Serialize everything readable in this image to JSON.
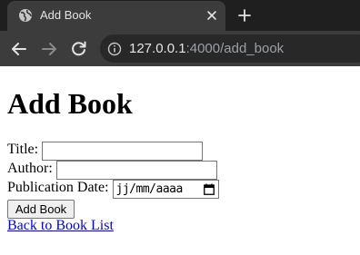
{
  "browser": {
    "tab_title": "Add Book",
    "url_host": "127.0.0.1",
    "url_path": ":4000/add_book",
    "icons": {
      "tab": "globe-icon",
      "close": "close-icon",
      "new_tab": "plus-icon",
      "back": "back-arrow-icon",
      "forward": "forward-arrow-icon",
      "reload": "reload-icon",
      "site_info": "info-icon"
    }
  },
  "page": {
    "heading": "Add Book",
    "fields": {
      "title_label": "Title:",
      "title_value": "",
      "author_label": "Author:",
      "author_value": "",
      "date_label": "Publication Date:",
      "date_placeholder": "jj/mm/aaaa"
    },
    "submit_label": "Add Book",
    "back_link": "Back to Book List"
  }
}
